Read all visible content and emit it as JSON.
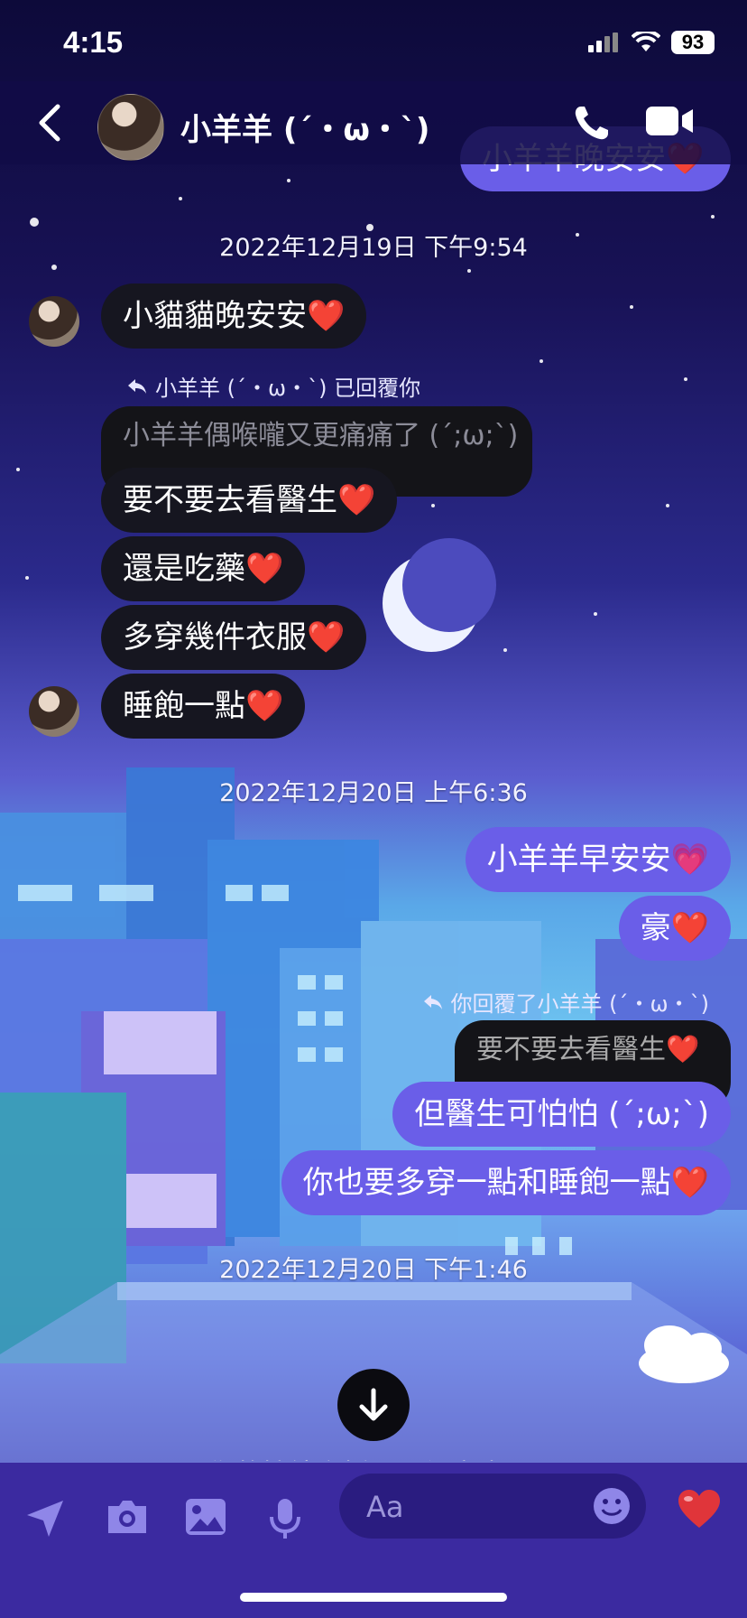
{
  "status": {
    "time": "4:15",
    "battery": "93"
  },
  "header": {
    "name": "小羊羊 (´・ω・`)"
  },
  "timestamps": [
    "2022年12月19日 下午9:54",
    "2022年12月20日 上午6:36",
    "2022年12月20日 下午1:46"
  ],
  "top_partial": "小羊羊晚安安❤️",
  "incoming": {
    "m1": "小貓貓晚安安❤️",
    "reply_label": "小羊羊 (´・ω・`) 已回覆你",
    "quoted": "小羊羊偶喉嚨又更痛痛了 (´;ω;`)",
    "m2": "要不要去看醫生❤️",
    "m3": "還是吃藥❤️",
    "m4": "多穿幾件衣服❤️",
    "m5": "睡飽一點❤️"
  },
  "outgoing": {
    "m1": "小羊羊早安安💗",
    "m2": "豪❤️",
    "reply_label": "你回覆了小羊羊 (´・ω・`)",
    "quoted": "要不要去看醫生❤️",
    "m3": "但醫生可怕怕 (´;ω;`)",
    "m4": "你也要多穿一點和睡飽一點❤️"
  },
  "peek_text": "你將持續之播回覆視窗先❤️",
  "input": {
    "placeholder": "Aa"
  },
  "colors": {
    "outgoing_bubble": "#6a5ee8",
    "incoming_bubble": "#161620",
    "input_bar": "#3b2aa0"
  }
}
